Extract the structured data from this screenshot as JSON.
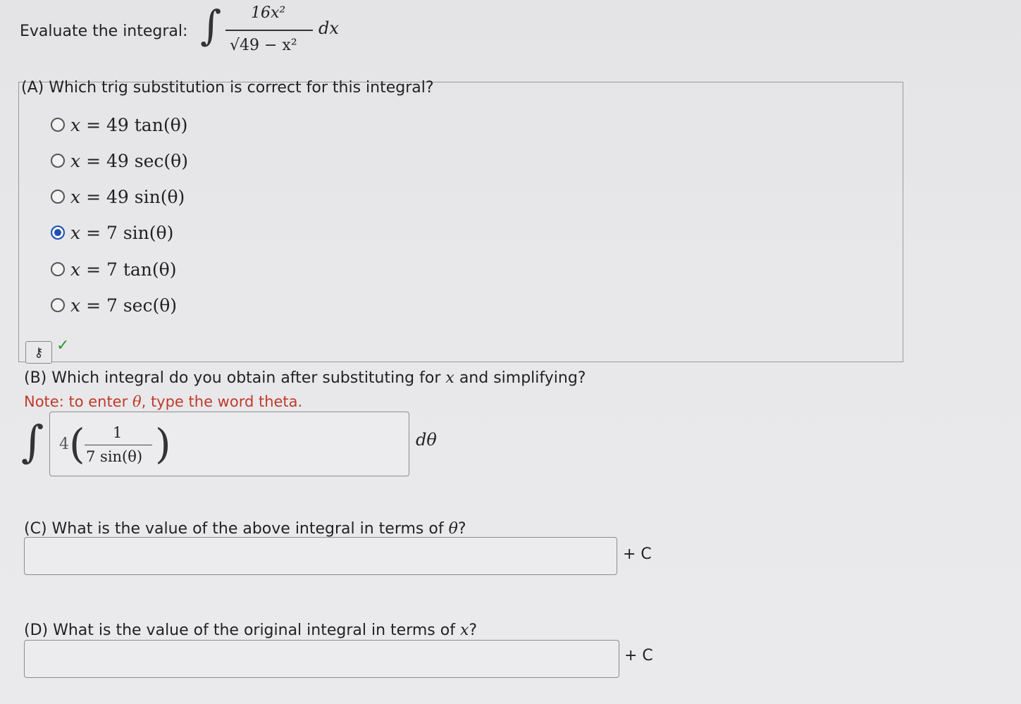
{
  "prompt": "Evaluate the integral:",
  "integral": {
    "numerator": "16x²",
    "denominator": "√49 − x²",
    "differential": "dx"
  },
  "partA": {
    "question": "(A) Which trig substitution is correct for this integral?",
    "options": [
      {
        "lhs": "x",
        "rhs": "= 49 tan(θ)",
        "selected": false
      },
      {
        "lhs": "x",
        "rhs": "= 49 sec(θ)",
        "selected": false
      },
      {
        "lhs": "x",
        "rhs": "= 49 sin(θ)",
        "selected": false
      },
      {
        "lhs": "x",
        "rhs": "= 7 sin(θ)",
        "selected": true
      },
      {
        "lhs": "x",
        "rhs": "= 7 tan(θ)",
        "selected": false
      },
      {
        "lhs": "x",
        "rhs": "= 7 sec(θ)",
        "selected": false
      }
    ],
    "key_icon": "⚷",
    "check": "✓"
  },
  "partB": {
    "question_pre": "(B) Which integral do you obtain after substituting for",
    "question_var": "x",
    "question_post": "and simplifying?",
    "note_pre": "Note: to enter",
    "note_var": "θ",
    "note_post": ", type the word theta.",
    "answer": {
      "coef": "4",
      "numerator": "1",
      "denominator": "7 sin(θ)"
    },
    "differential": "dθ"
  },
  "partC": {
    "question_pre": "(C) What is the value of the above integral in terms of",
    "question_var": "θ",
    "question_post": "?",
    "answer": "",
    "suffix": "+ C"
  },
  "partD": {
    "question_pre": "(D) What is the value of the original integral in terms of",
    "question_var": "x",
    "question_post": "?",
    "answer": "",
    "suffix": "+ C"
  }
}
